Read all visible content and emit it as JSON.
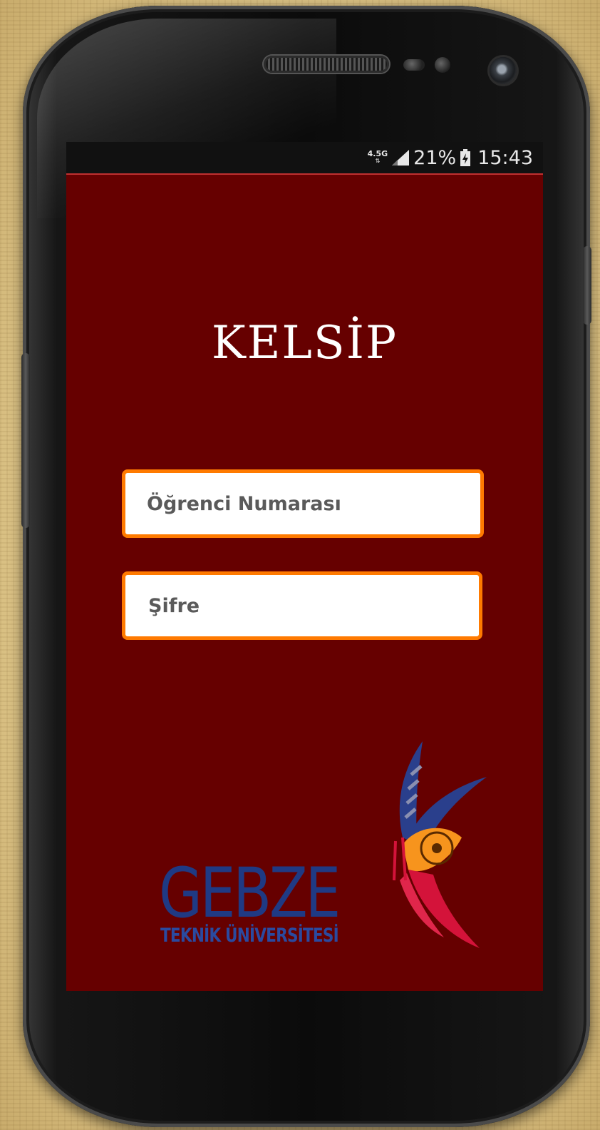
{
  "status_bar": {
    "network_type": "4.5G",
    "battery_percent": "21%",
    "time": "15:43",
    "icons": [
      "signal-icon",
      "battery-charging-icon"
    ]
  },
  "app": {
    "title": "KELSİP",
    "student_number_placeholder": "Öğrenci Numarası",
    "password_placeholder": "Şifre"
  },
  "logo": {
    "name": "GEBZE",
    "subtitle": "TEKNİK ÜNİVERSİTESİ"
  },
  "colors": {
    "screen_background": "#660000",
    "field_border": "#ff7a00",
    "logo_blue": "#1f3a84"
  }
}
